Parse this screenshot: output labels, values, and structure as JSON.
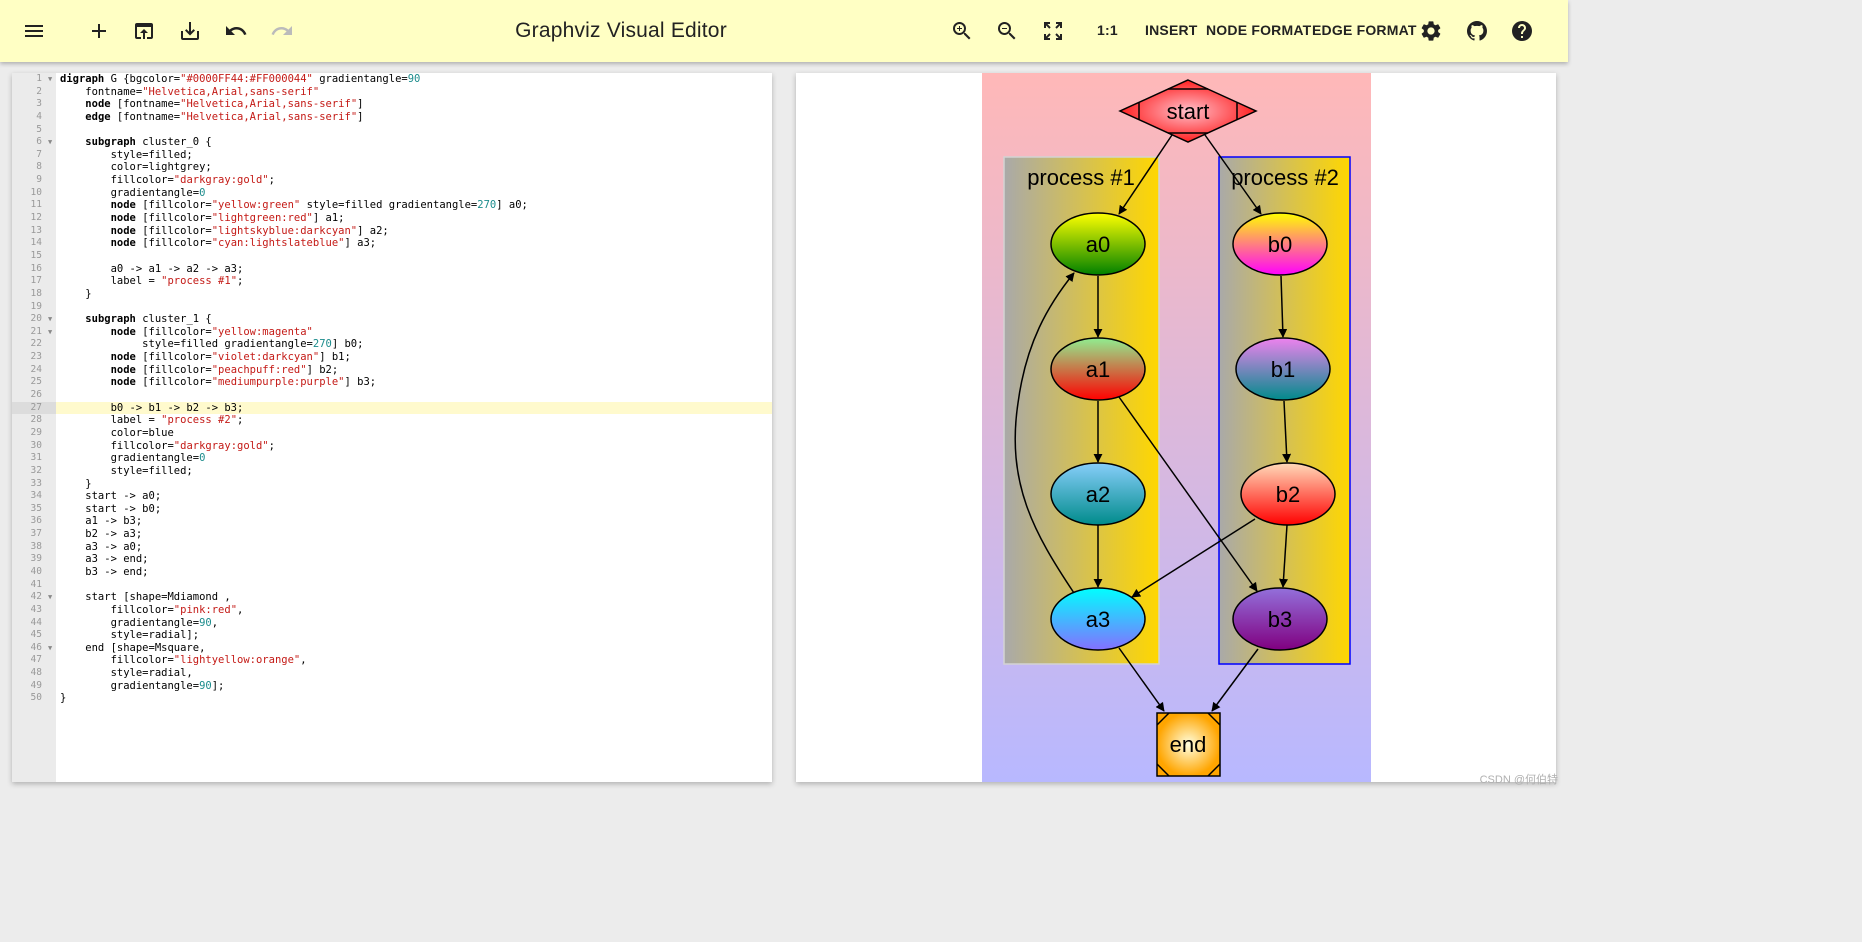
{
  "toolbar": {
    "title": "Graphviz Visual Editor",
    "actual_size_label": "1:1",
    "insert_label": "INSERT",
    "node_format_label": "NODE FORMAT",
    "edge_format_label": "EDGE FORMAT",
    "icons": [
      "menu-icon",
      "add-icon",
      "open-icon",
      "download-icon",
      "undo-icon",
      "redo-icon",
      "zoom-in-icon",
      "zoom-out-icon",
      "fit-icon",
      "settings-icon",
      "github-icon",
      "help-icon"
    ]
  },
  "editor": {
    "active_line": 27,
    "lines": [
      [
        [
          "kw",
          "digraph"
        ],
        [
          "t",
          " G {bgcolor="
        ],
        [
          "str",
          "\"#0000FF44:#FF000044\""
        ],
        [
          "t",
          " gradientangle="
        ],
        [
          "num",
          "90"
        ]
      ],
      [
        [
          "t",
          "    fontname="
        ],
        [
          "str",
          "\"Helvetica,Arial,sans-serif\""
        ]
      ],
      [
        [
          "t",
          "    "
        ],
        [
          "kw",
          "node"
        ],
        [
          "t",
          " [fontname="
        ],
        [
          "str",
          "\"Helvetica,Arial,sans-serif\""
        ],
        [
          "t",
          "]"
        ]
      ],
      [
        [
          "t",
          "    "
        ],
        [
          "kw",
          "edge"
        ],
        [
          "t",
          " [fontname="
        ],
        [
          "str",
          "\"Helvetica,Arial,sans-serif\""
        ],
        [
          "t",
          "]"
        ]
      ],
      [],
      [
        [
          "t",
          "    "
        ],
        [
          "kw",
          "subgraph"
        ],
        [
          "t",
          " cluster_0 {"
        ]
      ],
      [
        [
          "t",
          "        style=filled;"
        ]
      ],
      [
        [
          "t",
          "        color=lightgrey;"
        ]
      ],
      [
        [
          "t",
          "        fillcolor="
        ],
        [
          "str",
          "\"darkgray:gold\""
        ],
        [
          "t",
          ";"
        ]
      ],
      [
        [
          "t",
          "        gradientangle="
        ],
        [
          "num",
          "0"
        ]
      ],
      [
        [
          "t",
          "        "
        ],
        [
          "kw",
          "node"
        ],
        [
          "t",
          " [fillcolor="
        ],
        [
          "str",
          "\"yellow:green\""
        ],
        [
          "t",
          " style=filled gradientangle="
        ],
        [
          "num",
          "270"
        ],
        [
          "t",
          "] a0;"
        ]
      ],
      [
        [
          "t",
          "        "
        ],
        [
          "kw",
          "node"
        ],
        [
          "t",
          " [fillcolor="
        ],
        [
          "str",
          "\"lightgreen:red\""
        ],
        [
          "t",
          "] a1;"
        ]
      ],
      [
        [
          "t",
          "        "
        ],
        [
          "kw",
          "node"
        ],
        [
          "t",
          " [fillcolor="
        ],
        [
          "str",
          "\"lightskyblue:darkcyan\""
        ],
        [
          "t",
          "] a2;"
        ]
      ],
      [
        [
          "t",
          "        "
        ],
        [
          "kw",
          "node"
        ],
        [
          "t",
          " [fillcolor="
        ],
        [
          "str",
          "\"cyan:lightslateblue\""
        ],
        [
          "t",
          "] a3;"
        ]
      ],
      [],
      [
        [
          "t",
          "        a0 -> a1 -> a2 -> a3;"
        ]
      ],
      [
        [
          "t",
          "        label = "
        ],
        [
          "str",
          "\"process #1\""
        ],
        [
          "t",
          ";"
        ]
      ],
      [
        [
          "t",
          "    }"
        ]
      ],
      [],
      [
        [
          "t",
          "    "
        ],
        [
          "kw",
          "subgraph"
        ],
        [
          "t",
          " cluster_1 {"
        ]
      ],
      [
        [
          "t",
          "        "
        ],
        [
          "kw",
          "node"
        ],
        [
          "t",
          " [fillcolor="
        ],
        [
          "str",
          "\"yellow:magenta\""
        ]
      ],
      [
        [
          "t",
          "             style=filled gradientangle="
        ],
        [
          "num",
          "270"
        ],
        [
          "t",
          "] b0;"
        ]
      ],
      [
        [
          "t",
          "        "
        ],
        [
          "kw",
          "node"
        ],
        [
          "t",
          " [fillcolor="
        ],
        [
          "str",
          "\"violet:darkcyan\""
        ],
        [
          "t",
          "] b1;"
        ]
      ],
      [
        [
          "t",
          "        "
        ],
        [
          "kw",
          "node"
        ],
        [
          "t",
          " [fillcolor="
        ],
        [
          "str",
          "\"peachpuff:red\""
        ],
        [
          "t",
          "] b2;"
        ]
      ],
      [
        [
          "t",
          "        "
        ],
        [
          "kw",
          "node"
        ],
        [
          "t",
          " [fillcolor="
        ],
        [
          "str",
          "\"mediumpurple:purple\""
        ],
        [
          "t",
          "] b3;"
        ]
      ],
      [],
      [
        [
          "t",
          "        b0 -> b1 -> b2 -> b3;"
        ]
      ],
      [
        [
          "t",
          "        label = "
        ],
        [
          "str",
          "\"process #2\""
        ],
        [
          "t",
          ";"
        ]
      ],
      [
        [
          "t",
          "        color=blue"
        ]
      ],
      [
        [
          "t",
          "        fillcolor="
        ],
        [
          "str",
          "\"darkgray:gold\""
        ],
        [
          "t",
          ";"
        ]
      ],
      [
        [
          "t",
          "        gradientangle="
        ],
        [
          "num",
          "0"
        ]
      ],
      [
        [
          "t",
          "        style=filled;"
        ]
      ],
      [
        [
          "t",
          "    }"
        ]
      ],
      [
        [
          "t",
          "    start -> a0;"
        ]
      ],
      [
        [
          "t",
          "    start -> b0;"
        ]
      ],
      [
        [
          "t",
          "    a1 -> b3;"
        ]
      ],
      [
        [
          "t",
          "    b2 -> a3;"
        ]
      ],
      [
        [
          "t",
          "    a3 -> a0;"
        ]
      ],
      [
        [
          "t",
          "    a3 -> end;"
        ]
      ],
      [
        [
          "t",
          "    b3 -> end;"
        ]
      ],
      [],
      [
        [
          "t",
          "    start [shape=Mdiamond ,"
        ]
      ],
      [
        [
          "t",
          "        fillcolor="
        ],
        [
          "str",
          "\"pink:red\""
        ],
        [
          "t",
          ","
        ]
      ],
      [
        [
          "t",
          "        gradientangle="
        ],
        [
          "num",
          "90"
        ],
        [
          "t",
          ","
        ]
      ],
      [
        [
          "t",
          "        style=radial];"
        ]
      ],
      [
        [
          "t",
          "    end [shape=Msquare,"
        ]
      ],
      [
        [
          "t",
          "        fillcolor="
        ],
        [
          "str",
          "\"lightyellow:orange\""
        ],
        [
          "t",
          ","
        ]
      ],
      [
        [
          "t",
          "        style=radial,"
        ]
      ],
      [
        [
          "t",
          "        gradientangle="
        ],
        [
          "num",
          "90"
        ],
        [
          "t",
          "];"
        ]
      ],
      [
        [
          "t",
          "}"
        ]
      ]
    ],
    "fold_lines": [
      1,
      6,
      20,
      21,
      42,
      46
    ]
  },
  "graph": {
    "cluster_labels": [
      "process #1",
      "process #2"
    ],
    "nodes": [
      "start",
      "a0",
      "a1",
      "a2",
      "a3",
      "b0",
      "b1",
      "b2",
      "b3",
      "end"
    ]
  },
  "watermark": "CSDN @何伯特"
}
